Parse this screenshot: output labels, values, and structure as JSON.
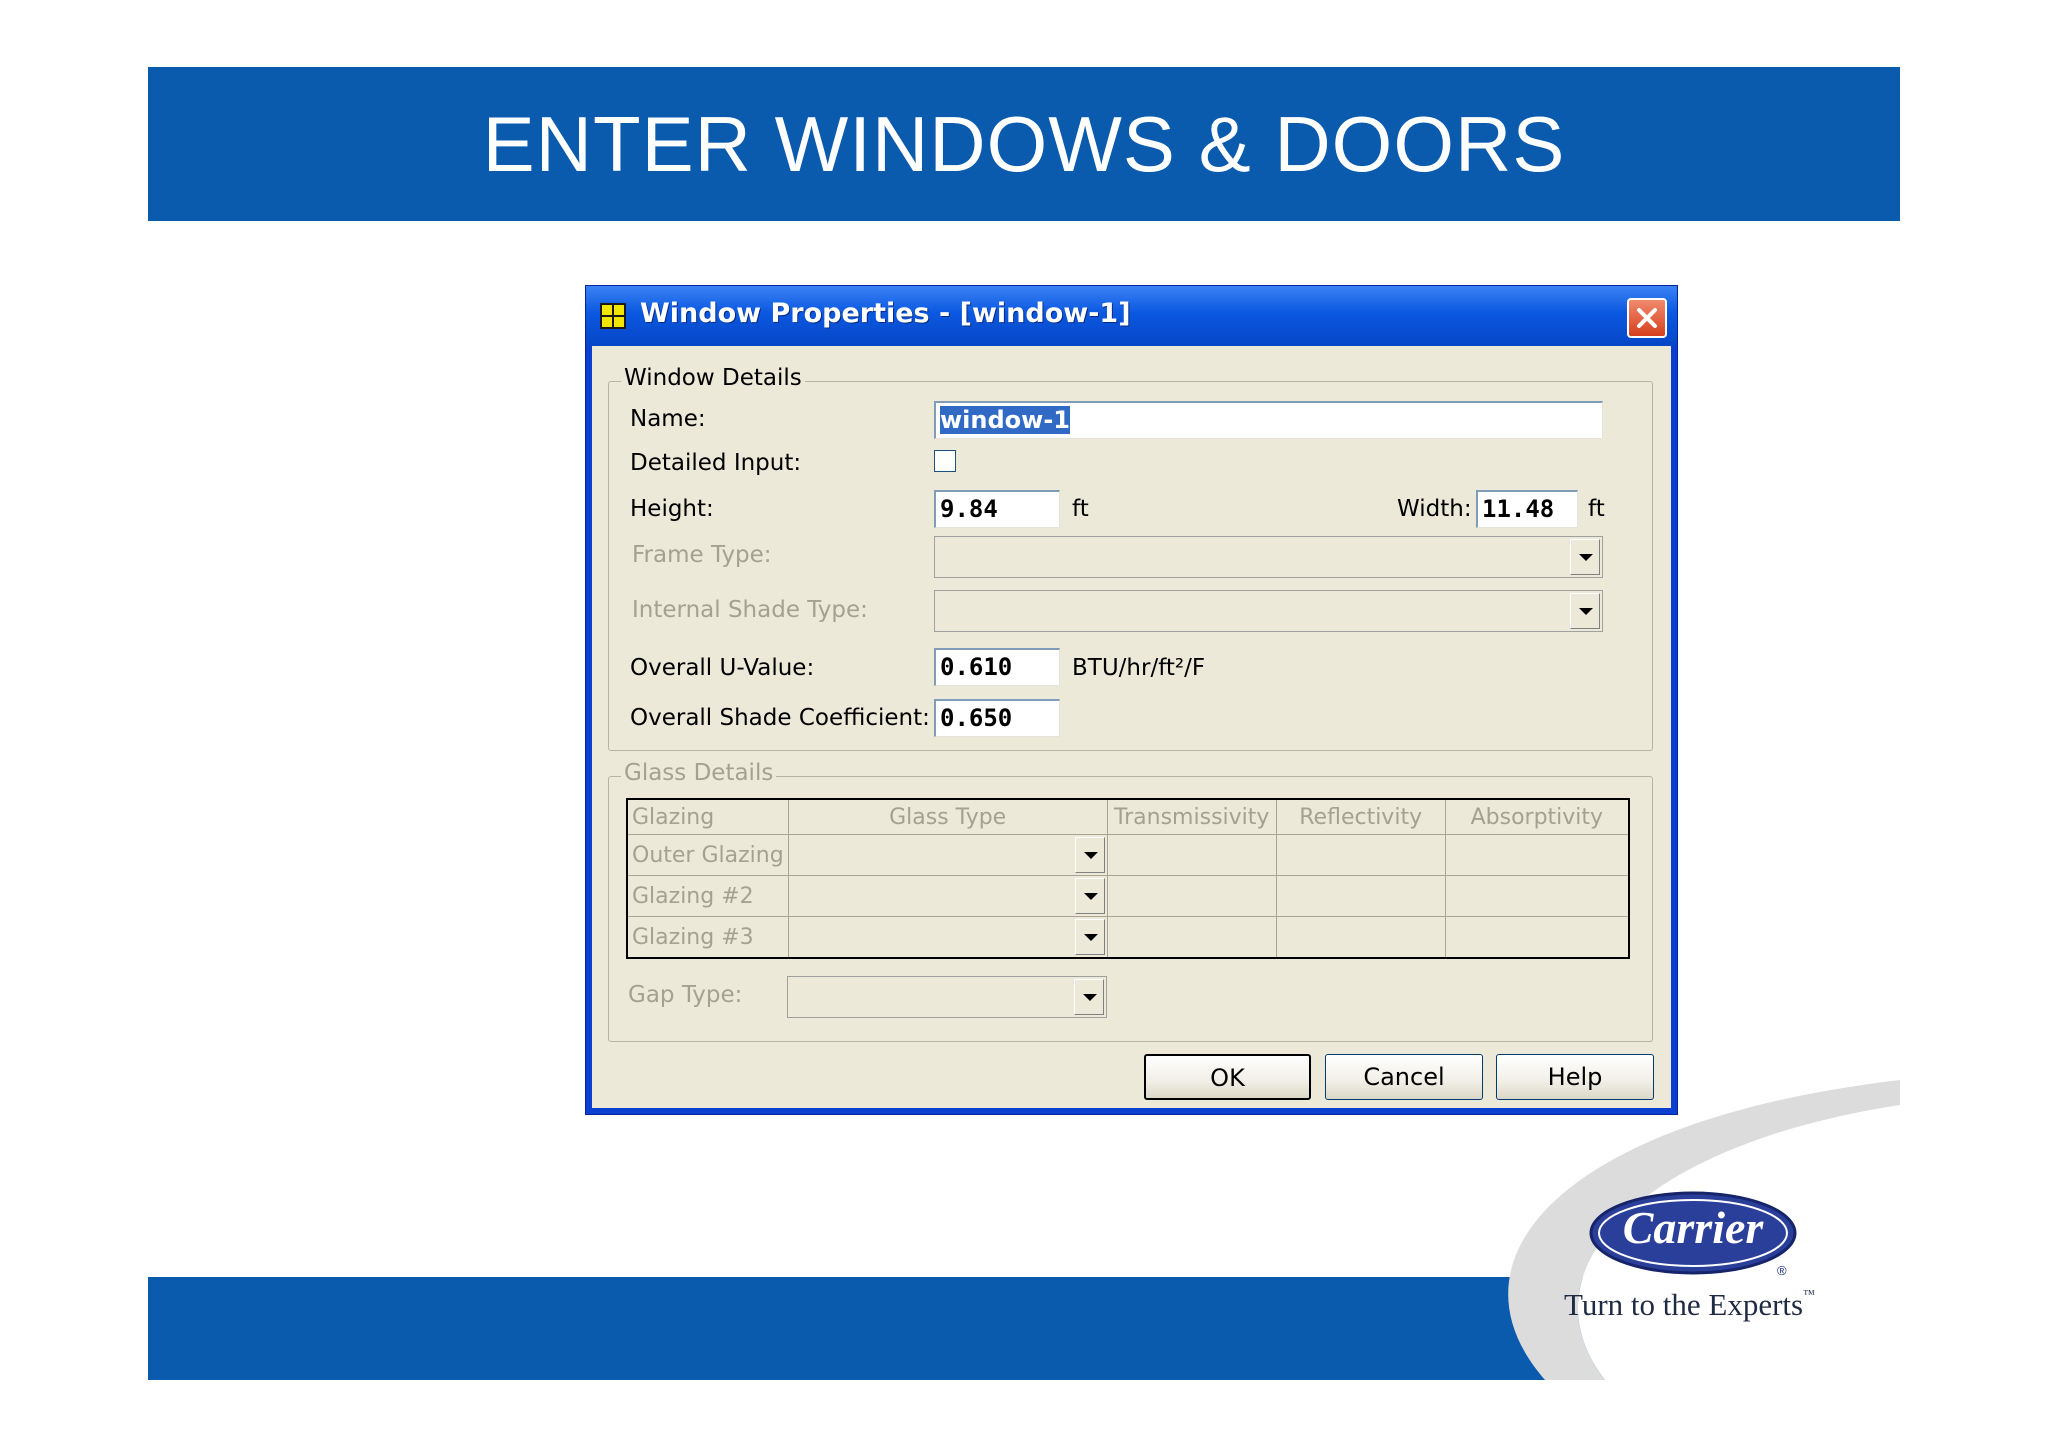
{
  "slide": {
    "title": "ENTER WINDOWS & DOORS"
  },
  "dialog": {
    "title": "Window Properties - [window-1]",
    "window_details": {
      "legend": "Window Details",
      "name_label": "Name:",
      "name_value": "window-1",
      "detailed_input_label": "Detailed Input:",
      "detailed_input_checked": false,
      "height_label": "Height:",
      "height_value": "9.84",
      "height_unit": "ft",
      "width_label": "Width:",
      "width_value": "11.48",
      "width_unit": "ft",
      "frame_type_label": "Frame Type:",
      "frame_type_value": "",
      "internal_shade_label": "Internal Shade Type:",
      "internal_shade_value": "",
      "u_value_label": "Overall U-Value:",
      "u_value": "0.610",
      "u_value_unit": "BTU/hr/ft²/F",
      "shade_coeff_label": "Overall Shade Coefficient:",
      "shade_coeff_value": "0.650"
    },
    "glass_details": {
      "legend": "Glass Details",
      "columns": [
        "Glazing",
        "Glass Type",
        "Transmissivity",
        "Reflectivity",
        "Absorptivity"
      ],
      "rows": [
        {
          "glazing": "Outer Glazing",
          "glass_type": "",
          "transmissivity": "",
          "reflectivity": "",
          "absorptivity": ""
        },
        {
          "glazing": "Glazing #2",
          "glass_type": "",
          "transmissivity": "",
          "reflectivity": "",
          "absorptivity": ""
        },
        {
          "glazing": "Glazing #3",
          "glass_type": "",
          "transmissivity": "",
          "reflectivity": "",
          "absorptivity": ""
        }
      ],
      "gap_type_label": "Gap Type:",
      "gap_type_value": ""
    },
    "buttons": {
      "ok": "OK",
      "cancel": "Cancel",
      "help": "Help"
    }
  },
  "logo": {
    "brand": "Carrier",
    "registered": "®",
    "tagline": "Turn to the Experts",
    "tagline_tm": "™"
  },
  "colors": {
    "banner": "#0a5aad",
    "titlebar": "#0b58e0",
    "dialog_bg": "#ece9d8",
    "selection": "#316ac5",
    "close": "#d6401e",
    "logo": "#2a3f9a"
  },
  "icons": {
    "app": "window-grid-icon",
    "close": "close-icon",
    "dropdown": "chevron-down-icon"
  }
}
